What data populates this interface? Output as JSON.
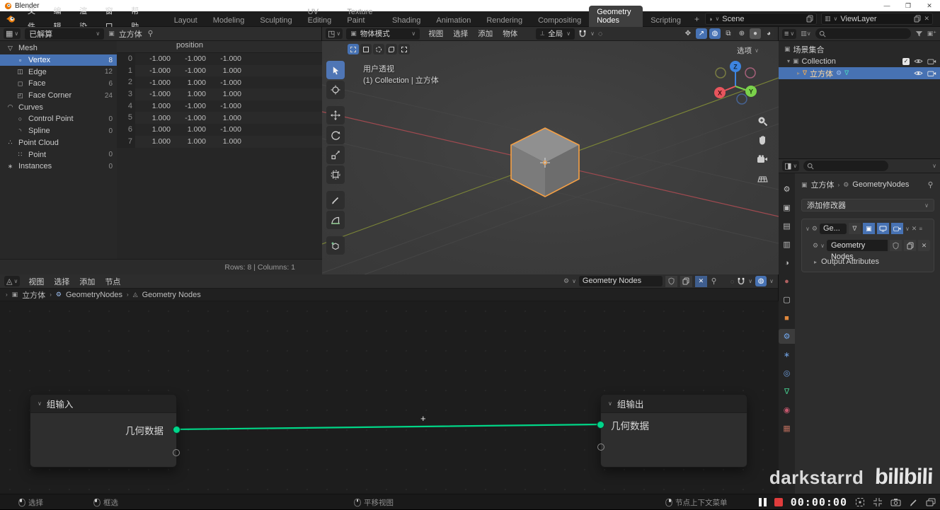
{
  "window": {
    "title": "Blender"
  },
  "topbar": {
    "menus": [
      {
        "id": "file",
        "label": "文件"
      },
      {
        "id": "edit",
        "label": "编辑"
      },
      {
        "id": "render",
        "label": "渲染"
      },
      {
        "id": "window",
        "label": "窗口"
      },
      {
        "id": "help",
        "label": "帮助"
      }
    ],
    "tabs": [
      "Layout",
      "Modeling",
      "Sculpting",
      "UV Editing",
      "Texture Paint",
      "Shading",
      "Animation",
      "Rendering",
      "Compositing",
      "Geometry Nodes",
      "Scripting"
    ],
    "active_tab": "Geometry Nodes",
    "add_tab": "+",
    "scene": "Scene",
    "view_layer": "ViewLayer"
  },
  "spreadsheet": {
    "mode": "已解算",
    "object": "立方体",
    "tree": [
      {
        "id": "mesh",
        "icon": "▽",
        "label": "Mesh",
        "count": "",
        "indent": 0,
        "selected": false
      },
      {
        "id": "vertex",
        "icon": "▫",
        "label": "Vertex",
        "count": "8",
        "indent": 1,
        "selected": true
      },
      {
        "id": "edge",
        "icon": "◫",
        "label": "Edge",
        "count": "12",
        "indent": 1,
        "selected": false
      },
      {
        "id": "face",
        "icon": "◻",
        "label": "Face",
        "count": "6",
        "indent": 1,
        "selected": false
      },
      {
        "id": "face-corner",
        "icon": "◰",
        "label": "Face Corner",
        "count": "24",
        "indent": 1,
        "selected": false
      },
      {
        "id": "curves",
        "icon": "◠",
        "label": "Curves",
        "count": "",
        "indent": 0,
        "selected": false
      },
      {
        "id": "control-point",
        "icon": "○",
        "label": "Control Point",
        "count": "0",
        "indent": 1,
        "selected": false
      },
      {
        "id": "spline",
        "icon": "◝",
        "label": "Spline",
        "count": "0",
        "indent": 1,
        "selected": false
      },
      {
        "id": "point-cloud",
        "icon": "∴",
        "label": "Point Cloud",
        "count": "",
        "indent": 0,
        "selected": false
      },
      {
        "id": "point",
        "icon": "∷",
        "label": "Point",
        "count": "0",
        "indent": 1,
        "selected": false
      },
      {
        "id": "instances",
        "icon": "∗",
        "label": "Instances",
        "count": "0",
        "indent": 0,
        "selected": false
      }
    ],
    "column_header": "position",
    "rows": [
      {
        "index": "0",
        "values": [
          "-1.000",
          "-1.000",
          "-1.000"
        ]
      },
      {
        "index": "1",
        "values": [
          "-1.000",
          "-1.000",
          "1.000"
        ]
      },
      {
        "index": "2",
        "values": [
          "-1.000",
          "1.000",
          "-1.000"
        ]
      },
      {
        "index": "3",
        "values": [
          "-1.000",
          "1.000",
          "1.000"
        ]
      },
      {
        "index": "4",
        "values": [
          "1.000",
          "-1.000",
          "-1.000"
        ]
      },
      {
        "index": "5",
        "values": [
          "1.000",
          "-1.000",
          "1.000"
        ]
      },
      {
        "index": "6",
        "values": [
          "1.000",
          "1.000",
          "-1.000"
        ]
      },
      {
        "index": "7",
        "values": [
          "1.000",
          "1.000",
          "1.000"
        ]
      }
    ],
    "footer": "Rows: 8 | Columns: 1"
  },
  "viewport": {
    "mode": "物体模式",
    "menus": [
      {
        "id": "view",
        "label": "视图"
      },
      {
        "id": "select",
        "label": "选择"
      },
      {
        "id": "add",
        "label": "添加"
      },
      {
        "id": "object",
        "label": "物体"
      }
    ],
    "orientation": "全局",
    "view_label": "用户透视",
    "context_label": "(1) Collection | 立方体",
    "options_label": "选项",
    "gizmo": {
      "x": "X",
      "y": "Y",
      "z": "Z"
    }
  },
  "outliner": {
    "scene_collection": "场景集合",
    "collection": "Collection",
    "object": "立方体"
  },
  "properties": {
    "breadcrumb_object": "立方体",
    "breadcrumb_modifier": "GeometryNodes",
    "add_modifier_label": "添加修改器",
    "modifier_name": "Ge...",
    "node_group_name": "Geometry Nodes",
    "output_attributes_label": "Output Attributes",
    "tabs": [
      {
        "id": "tool",
        "glyph": "⚙",
        "color": "#c2c2c2",
        "active": false
      },
      {
        "id": "render",
        "glyph": "▣",
        "color": "#b8b8b8",
        "active": false
      },
      {
        "id": "output",
        "glyph": "▤",
        "color": "#b8b8b8",
        "active": false
      },
      {
        "id": "view-layer",
        "glyph": "▥",
        "color": "#b8b8b8",
        "active": false
      },
      {
        "id": "scene",
        "glyph": "◑",
        "color": "#b8b8b8",
        "active": false
      },
      {
        "id": "world",
        "glyph": "●",
        "color": "#b06060",
        "active": false
      },
      {
        "id": "collection",
        "glyph": "▢",
        "color": "#c8c8c8",
        "active": false
      },
      {
        "id": "object",
        "glyph": "■",
        "color": "#e0883c",
        "active": false
      },
      {
        "id": "modifiers",
        "glyph": "⚙",
        "color": "#71a8f0",
        "active": true
      },
      {
        "id": "particles",
        "glyph": "∗",
        "color": "#6f9fde",
        "active": false
      },
      {
        "id": "physics",
        "glyph": "◎",
        "color": "#6f9fde",
        "active": false
      },
      {
        "id": "object-data",
        "glyph": "∇",
        "color": "#44c58a",
        "active": false
      },
      {
        "id": "material",
        "glyph": "◉",
        "color": "#c4576d",
        "active": false
      },
      {
        "id": "texture",
        "glyph": "▦",
        "color": "#b56a5a",
        "active": false
      }
    ]
  },
  "node_editor": {
    "menus": [
      {
        "id": "view",
        "label": "视图"
      },
      {
        "id": "select",
        "label": "选择"
      },
      {
        "id": "add",
        "label": "添加"
      },
      {
        "id": "node",
        "label": "节点"
      }
    ],
    "group_selector": "Geometry Nodes",
    "breadcrumb": [
      "立方体",
      "GeometryNodes",
      "Geometry Nodes"
    ],
    "input_node": {
      "title": "组输入",
      "socket": "几何数据"
    },
    "output_node": {
      "title": "组输出",
      "socket": "几何数据"
    }
  },
  "statusbar": {
    "hints": [
      {
        "id": "select",
        "label": "选择",
        "button": "left"
      },
      {
        "id": "box-select",
        "label": "框选",
        "button": "left"
      },
      {
        "id": "pan-view",
        "label": "平移视图",
        "button": "middle"
      },
      {
        "id": "node-context-menu",
        "label": "节点上下文菜单",
        "button": "right"
      }
    ],
    "timer": "00:00:00"
  },
  "watermark": {
    "name": "darkstarrd",
    "logo": "bilibili"
  },
  "colors": {
    "accent_blue": "#4772b3",
    "socket_green": "#00d68b",
    "wire_green": "#00d687",
    "selection_orange": "#f5a045"
  }
}
